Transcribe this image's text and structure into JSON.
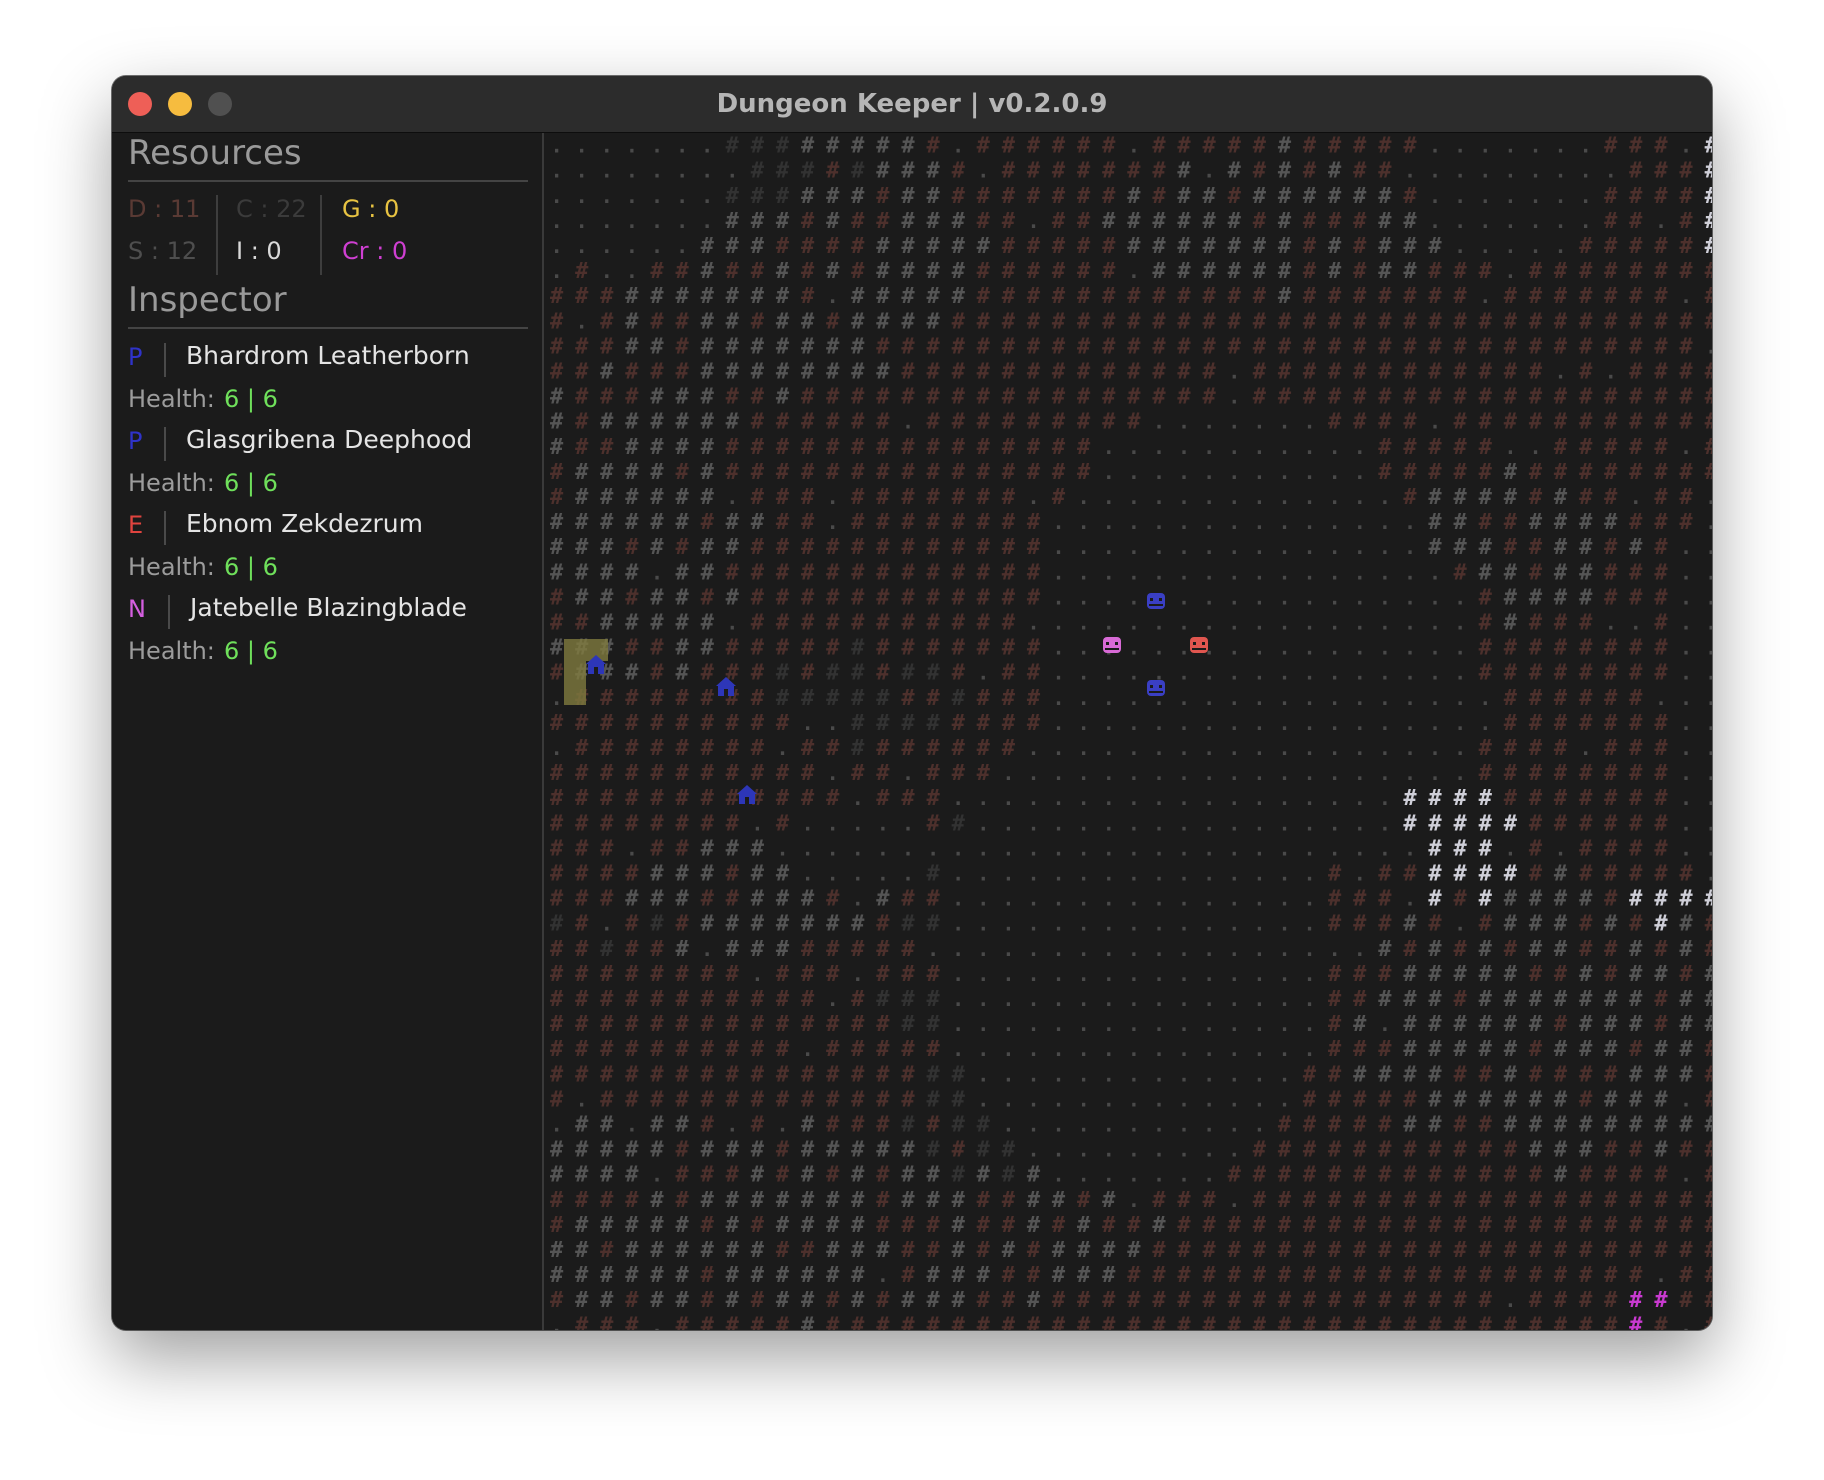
{
  "window": {
    "title": "Dungeon Keeper | v0.2.0.9"
  },
  "resources": {
    "heading": "Resources",
    "items": [
      {
        "key": "dirt",
        "label": "D : 11",
        "color": "#5a3a34"
      },
      {
        "key": "coal",
        "label": "C : 22",
        "color": "#3b3b3b"
      },
      {
        "key": "gold",
        "label": "G : 0",
        "color": "#e8c342"
      },
      {
        "key": "stone",
        "label": "S : 12",
        "color": "#4e4e4e"
      },
      {
        "key": "iron",
        "label": "I : 0",
        "color": "#d9d9d9"
      },
      {
        "key": "crystal",
        "label": "Cr : 0",
        "color": "#cf3fd2"
      }
    ]
  },
  "inspector": {
    "heading": "Inspector",
    "health_label": "Health:",
    "entities": [
      {
        "tag": "P",
        "tag_color": "#2f33c9",
        "name": "Bhardrom Leatherborn",
        "health": "6 | 6"
      },
      {
        "tag": "P",
        "tag_color": "#2f33c9",
        "name": "Glasgribena Deephood",
        "health": "6 | 6"
      },
      {
        "tag": "E",
        "tag_color": "#e0443f",
        "name": "Ebnom Zekdezrum",
        "health": "6 | 6"
      },
      {
        "tag": "N",
        "tag_color": "#d55fe0",
        "name": "Jatebelle Blazingblade",
        "health": "6 | 6"
      }
    ]
  },
  "map": {
    "tiles": {
      "dirt": {
        "glyph": "#",
        "color": "#4d302c"
      },
      "stone": {
        "glyph": "#",
        "color": "#555555"
      },
      "coal": {
        "glyph": "#",
        "color": "#323232"
      },
      "iron": {
        "glyph": "#",
        "color": "#cfcfd8"
      },
      "crystal": {
        "glyph": "#",
        "color": "#c93ad0"
      },
      "floor": {
        "glyph": ".",
        "color": "#4a4a4a"
      }
    },
    "creature_colors": {
      "player": "#3a3fc4",
      "enemy": "#e0564f",
      "neutral": "#d86ad6",
      "structure": "#2d36b8"
    },
    "zone_color": "#7f7a3e"
  }
}
